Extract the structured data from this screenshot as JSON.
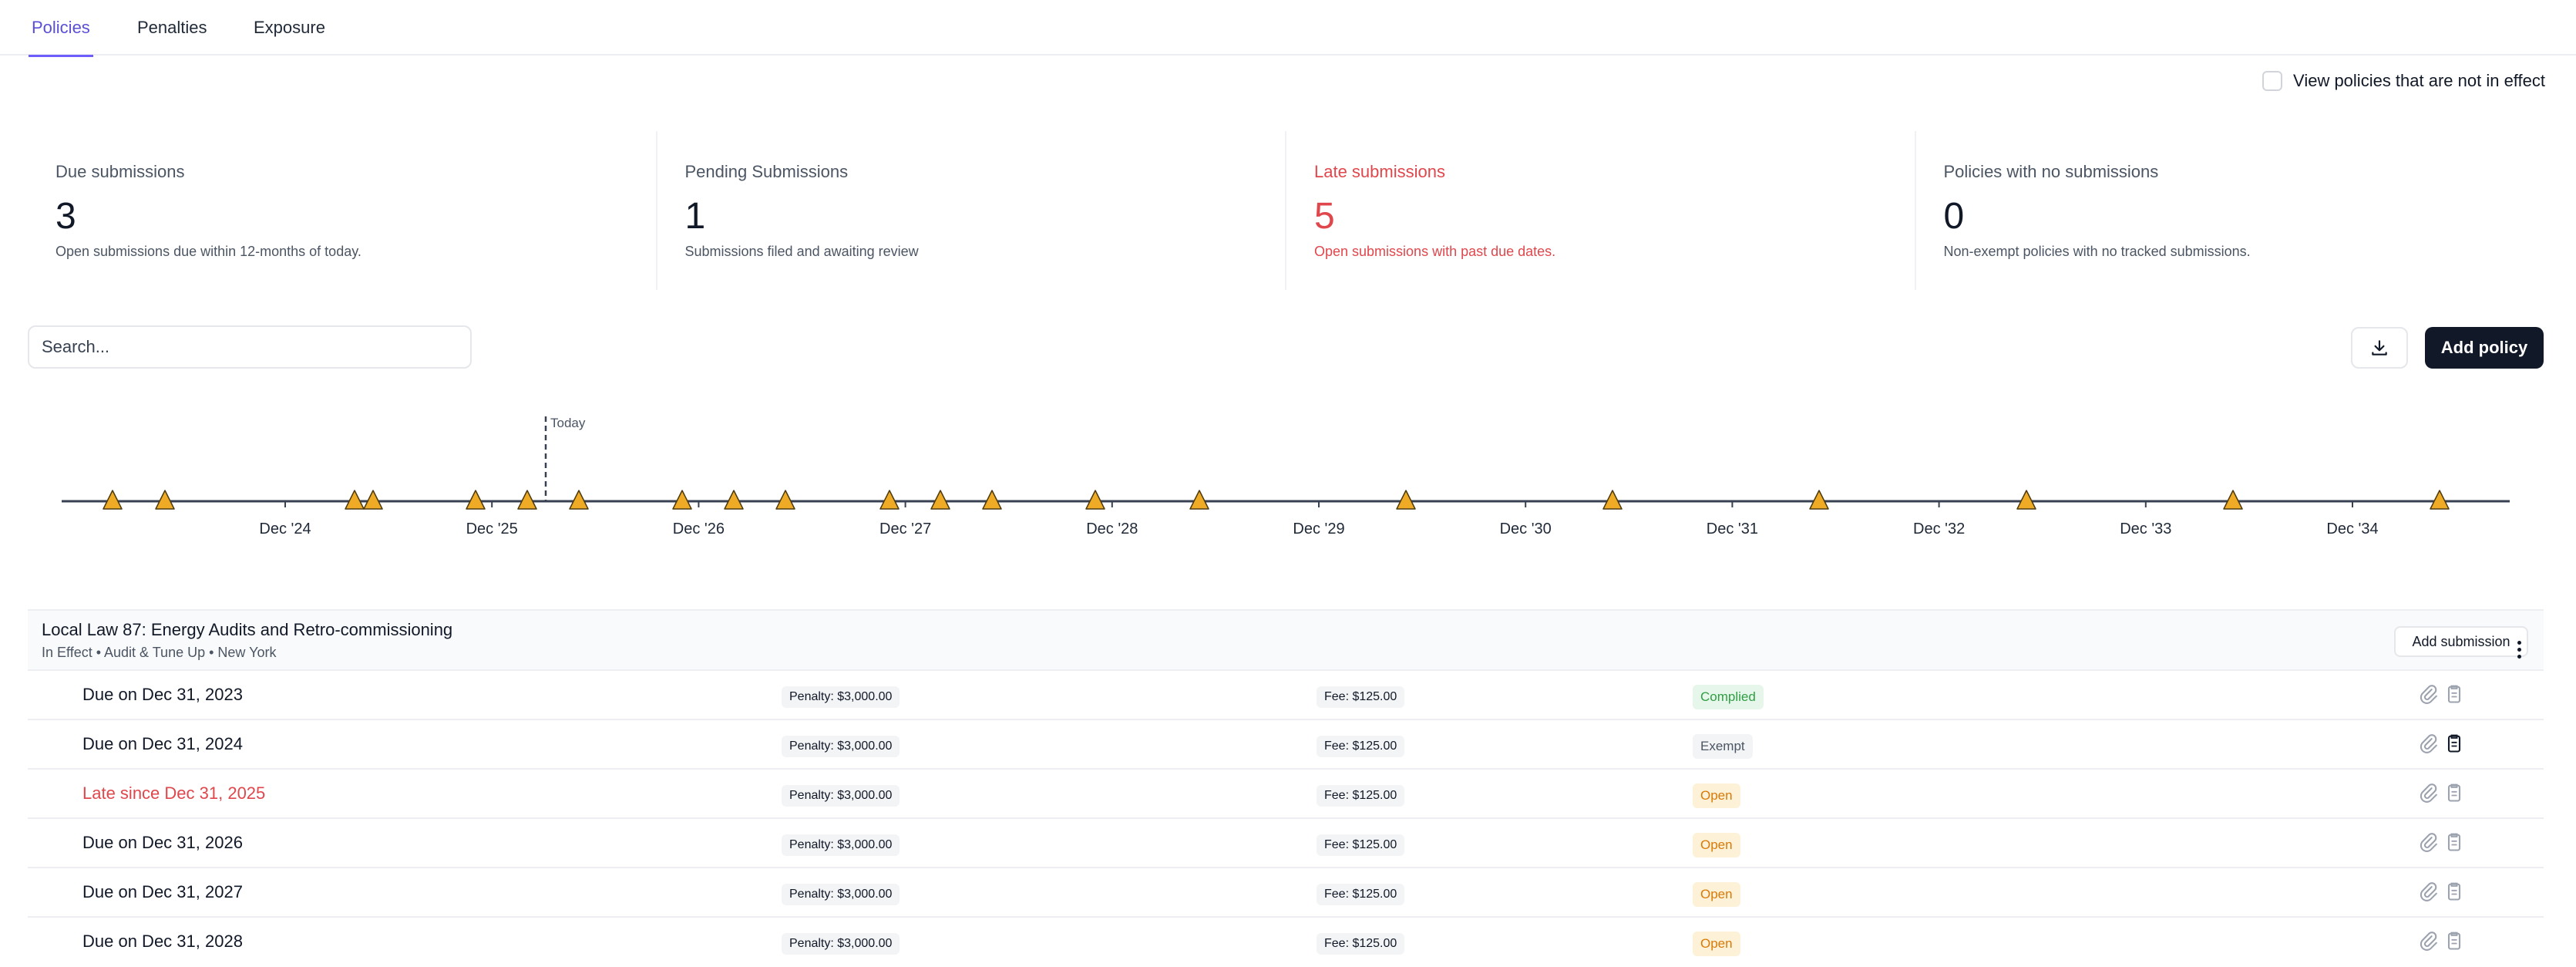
{
  "tabs": [
    {
      "label": "Policies",
      "active": true
    },
    {
      "label": "Penalties",
      "active": false
    },
    {
      "label": "Exposure",
      "active": false
    }
  ],
  "toggle_label": "View policies that are not in effect",
  "stats": [
    {
      "title": "Due submissions",
      "value": "3",
      "desc": "Open submissions due within 12-months of today."
    },
    {
      "title": "Pending Submissions",
      "value": "1",
      "desc": "Submissions filed and awaiting review"
    },
    {
      "title": "Late submissions",
      "value": "5",
      "desc": "Open submissions with past due dates."
    },
    {
      "title": "Policies with no submissions",
      "value": "0",
      "desc": "Non-exempt policies with no tracked submissions."
    }
  ],
  "search": {
    "placeholder": "Search..."
  },
  "actions": {
    "add_policy": "Add policy"
  },
  "timeline": {
    "today_label": "Today",
    "labels": [
      "Dec '24",
      "Dec '25",
      "Dec '26",
      "Dec '27",
      "Dec '28",
      "Dec '29",
      "Dec '30",
      "Dec '31",
      "Dec '32",
      "Dec '33",
      "Dec '34"
    ],
    "marker_color": "#f0ab26"
  },
  "policy": {
    "title": "Local Law 87: Energy Audits and Retro-commissioning",
    "meta": "In Effect • Audit & Tune Up • New York",
    "add_submission": "Add submission",
    "rows": [
      {
        "due": "Due on Dec 31, 2023",
        "penalty": "Penalty: $3,000.00",
        "fee": "Fee: $125.00",
        "status": "Complied"
      },
      {
        "due": "Due on Dec 31, 2024",
        "penalty": "Penalty: $3,000.00",
        "fee": "Fee: $125.00",
        "status": "Exempt"
      },
      {
        "due": "Late since Dec 31, 2025",
        "penalty": "Penalty: $3,000.00",
        "fee": "Fee: $125.00",
        "status": "Open"
      },
      {
        "due": "Due on Dec 31, 2026",
        "penalty": "Penalty: $3,000.00",
        "fee": "Fee: $125.00",
        "status": "Open"
      },
      {
        "due": "Due on Dec 31, 2027",
        "penalty": "Penalty: $3,000.00",
        "fee": "Fee: $125.00",
        "status": "Open"
      },
      {
        "due": "Due on Dec 31, 2028",
        "penalty": "Penalty: $3,000.00",
        "fee": "Fee: $125.00",
        "status": "Open"
      }
    ]
  },
  "colors": {
    "accent": "#6d5dfc",
    "danger": "#e0474c",
    "primary_button": "#111827"
  }
}
